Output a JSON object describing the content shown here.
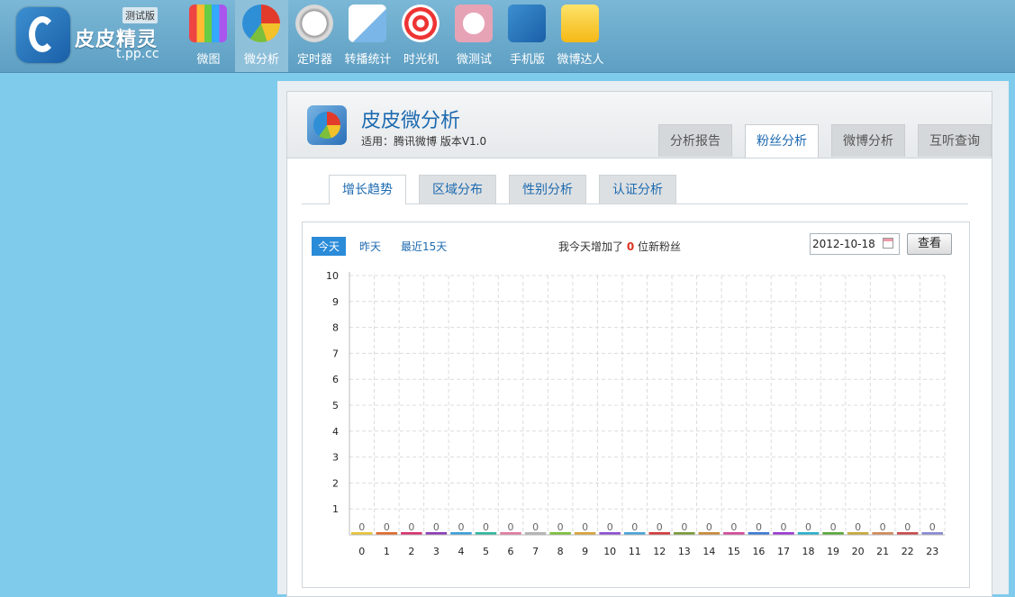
{
  "header": {
    "brand_name": "皮皮精灵",
    "brand_url": "t.pp.cc",
    "beta_badge": "测试版",
    "nav": [
      {
        "label": "微图",
        "icon": "camera-icon",
        "active": false
      },
      {
        "label": "微分析",
        "icon": "pie-chart-icon",
        "active": true
      },
      {
        "label": "定时器",
        "icon": "stopwatch-icon",
        "active": false
      },
      {
        "label": "转播统计",
        "icon": "trend-chart-icon",
        "active": false
      },
      {
        "label": "时光机",
        "icon": "swirl-icon",
        "active": false
      },
      {
        "label": "微测试",
        "icon": "clover-icon",
        "active": false
      },
      {
        "label": "手机版",
        "icon": "phone-app-icon",
        "active": false
      },
      {
        "label": "微博达人",
        "icon": "star-icon",
        "active": false
      }
    ]
  },
  "app": {
    "title": "皮皮微分析",
    "subtitle": "适用：腾讯微博 版本V1.0",
    "main_tabs": [
      "分析报告",
      "粉丝分析",
      "微博分析",
      "互听查询"
    ],
    "active_main_tab": "粉丝分析",
    "sub_tabs": [
      "增长趋势",
      "区域分布",
      "性别分析",
      "认证分析"
    ],
    "active_sub_tab": "增长趋势"
  },
  "filters": {
    "ranges": [
      "今天",
      "昨天",
      "最近15天"
    ],
    "active_range": "今天",
    "summary_prefix": "我今天增加了",
    "summary_count": "0",
    "summary_suffix": "位新粉丝",
    "date_value": "2012-10-18",
    "view_button": "查看"
  },
  "chart_data": {
    "type": "bar",
    "categories": [
      "0",
      "1",
      "2",
      "3",
      "4",
      "5",
      "6",
      "7",
      "8",
      "9",
      "10",
      "11",
      "12",
      "13",
      "14",
      "15",
      "16",
      "17",
      "18",
      "19",
      "20",
      "21",
      "22",
      "23"
    ],
    "values": [
      0,
      0,
      0,
      0,
      0,
      0,
      0,
      0,
      0,
      0,
      0,
      0,
      0,
      0,
      0,
      0,
      0,
      0,
      0,
      0,
      0,
      0,
      0,
      0
    ],
    "ylim": [
      0,
      10
    ],
    "yticks": [
      "1",
      "2",
      "3",
      "4",
      "5",
      "6",
      "7",
      "8",
      "9",
      "10"
    ],
    "grid": true,
    "bar_colors": [
      "#e8c33a",
      "#e06a2c",
      "#d8316f",
      "#8c3bb5",
      "#3c9fd8",
      "#2fb7a0",
      "#e07ba0",
      "#b5b5b5",
      "#7cbf3c",
      "#d9a43a",
      "#8e4ed0",
      "#4aa4d8",
      "#d23a3a",
      "#7a9a3a",
      "#c98a3a",
      "#d24a9a",
      "#3a7ad2",
      "#9a3ad2",
      "#2ab0c8",
      "#5aa83a",
      "#c8a83a",
      "#d28a5a",
      "#c84a4a",
      "#8a8ad2"
    ]
  }
}
